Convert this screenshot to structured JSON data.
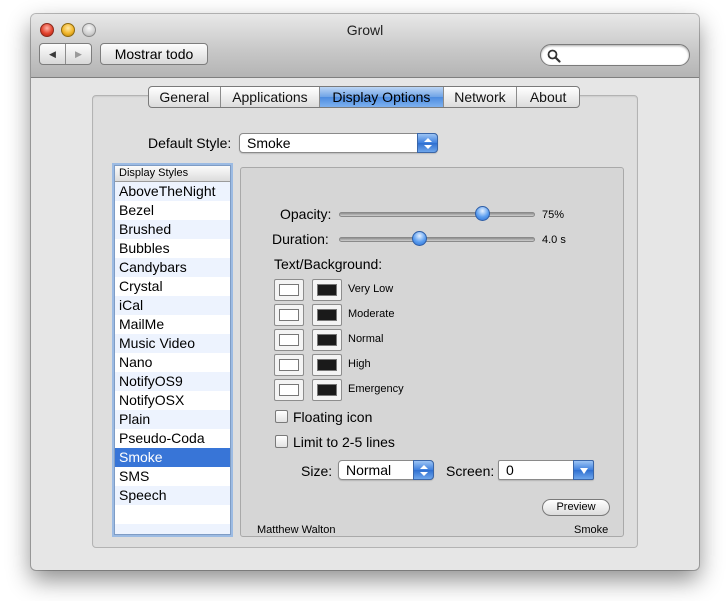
{
  "window": {
    "title": "Growl"
  },
  "toolbar": {
    "back_icon": "back-arrow-icon",
    "forward_icon": "forward-arrow-icon",
    "show_all_label": "Mostrar todo",
    "search_value": "",
    "search_placeholder": ""
  },
  "tabs": [
    {
      "label": "General",
      "active": false
    },
    {
      "label": "Applications",
      "active": false
    },
    {
      "label": "Display Options",
      "active": true
    },
    {
      "label": "Network",
      "active": false
    },
    {
      "label": "About",
      "active": false
    }
  ],
  "default_style": {
    "label": "Default Style:",
    "value": "Smoke"
  },
  "styles_list": {
    "header": "Display Styles",
    "items": [
      "AboveTheNight",
      "Bezel",
      "Brushed",
      "Bubbles",
      "Candybars",
      "Crystal",
      "iCal",
      "MailMe",
      "Music Video",
      "Nano",
      "NotifyOS9",
      "NotifyOSX",
      "Plain",
      "Pseudo-Coda",
      "Smoke",
      "SMS",
      "Speech"
    ],
    "selected": "Smoke"
  },
  "settings": {
    "opacity": {
      "label": "Opacity:",
      "value_text": "75%",
      "fraction": 0.73
    },
    "duration": {
      "label": "Duration:",
      "value_text": "4.0 s",
      "fraction": 0.41
    },
    "text_background_label": "Text/Background:",
    "priorities": [
      {
        "label": "Very Low",
        "text_color": "#ffffff",
        "background_color": "#1a1a1a"
      },
      {
        "label": "Moderate",
        "text_color": "#ffffff",
        "background_color": "#1a1a1a"
      },
      {
        "label": "Normal",
        "text_color": "#ffffff",
        "background_color": "#1a1a1a"
      },
      {
        "label": "High",
        "text_color": "#ffffff",
        "background_color": "#1a1a1a"
      },
      {
        "label": "Emergency",
        "text_color": "#ffffff",
        "background_color": "#1a1a1a"
      }
    ],
    "floating_icon": {
      "label": "Floating icon",
      "checked": false
    },
    "limit_lines": {
      "label": "Limit to 2-5 lines",
      "checked": false
    },
    "size": {
      "label": "Size:",
      "value": "Normal"
    },
    "screen": {
      "label": "Screen:",
      "value": "0"
    },
    "preview_label": "Preview",
    "author": "Matthew Walton",
    "style_name": "Smoke"
  },
  "colors": {
    "accent_blue": "#3875d7",
    "selected_tab": "#5a98e6"
  }
}
